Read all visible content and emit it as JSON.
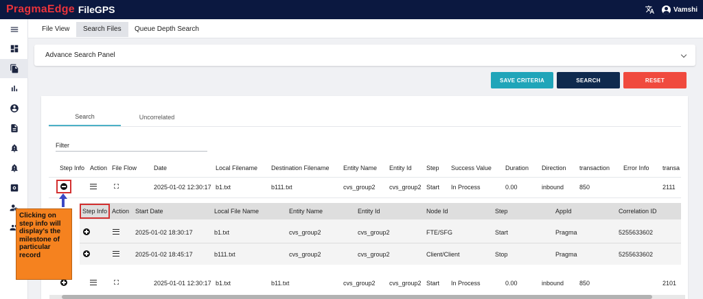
{
  "header": {
    "brand": "PragmaEdge",
    "app_name": "FileGPS",
    "user_name": "Vamshi",
    "translate_icon": "translate-icon",
    "user_icon": "account-circle-icon"
  },
  "sidebar": {
    "items": [
      {
        "icon": "menu-icon"
      },
      {
        "icon": "dashboard-icon"
      },
      {
        "icon": "files-icon",
        "active": true
      },
      {
        "icon": "bar-chart-icon"
      },
      {
        "icon": "account-icon"
      },
      {
        "icon": "document-icon"
      },
      {
        "icon": "alert-bell-icon"
      },
      {
        "icon": "alert-bell-icon"
      },
      {
        "icon": "settings-box-icon"
      },
      {
        "icon": "user-settings-icon"
      },
      {
        "icon": "group-icon"
      }
    ]
  },
  "tabs": {
    "file_view": "File View",
    "search_files": "Search Files",
    "queue_depth": "Queue Depth Search"
  },
  "advance_panel": {
    "title": "Advance Search Panel"
  },
  "buttons": {
    "save_criteria": "SAVE CRITERIA",
    "search": "SEARCH",
    "reset": "RESET",
    "colors": {
      "save": "#20a5b9",
      "search": "#0f2a4e",
      "reset": "#f04a3e"
    }
  },
  "inner_tabs": {
    "search": "Search",
    "uncorrelated": "Uncorrelated"
  },
  "filter": {
    "label": "Filter"
  },
  "main_table": {
    "headers": [
      "Step Info",
      "Action",
      "File Flow",
      "Date",
      "Local Filename",
      "Destination Filename",
      "Entity Name",
      "Entity Id",
      "Step",
      "Success Value",
      "Duration",
      "Direction",
      "transaction",
      "Error Info",
      "transa"
    ],
    "rows": [
      {
        "date": "2025-01-02 12:30:17",
        "local": "b1.txt",
        "dest": "b111.txt",
        "entity_name": "cvs_group2",
        "entity_id": "cvs_group2",
        "step": "Start",
        "success": "In Process",
        "duration": "0.00",
        "direction": "inbound",
        "transaction": "850",
        "error": "",
        "transa": "2111"
      },
      {
        "date": "2025-01-01 12:30:17",
        "local": "b1.txt",
        "dest": "b11.txt",
        "entity_name": "cvs_group2",
        "entity_id": "cvs_group2",
        "step": "Start",
        "success": "In Process",
        "duration": "0.00",
        "direction": "inbound",
        "transaction": "850",
        "error": "",
        "transa": "2101"
      }
    ]
  },
  "step_table": {
    "headers": [
      "Step Info",
      "Action",
      "Start Date",
      "Local File Name",
      "Entity Name",
      "Entity Id",
      "Node Id",
      "Step",
      "AppId",
      "Correlation ID"
    ],
    "rows": [
      {
        "start_date": "2025-01-02 18:30:17",
        "local": "b1.txt",
        "entity_name": "cvs_group2",
        "entity_id": "cvs_group2",
        "node": "FTE/SFG",
        "step": "Start",
        "app": "Pragma",
        "corr": "5255633602"
      },
      {
        "start_date": "2025-01-02 18:45:17",
        "local": "b111.txt",
        "entity_name": "cvs_group2",
        "entity_id": "cvs_group2",
        "node": "Client/Client",
        "step": "Stop",
        "app": "Pragma",
        "corr": "5255633602"
      }
    ]
  },
  "annotation": {
    "text": "Clicking on step info will display's the milestone of particular record",
    "color": "#f5821f",
    "highlight_color": "#d32f2f"
  }
}
